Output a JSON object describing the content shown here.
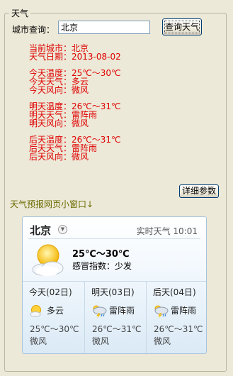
{
  "group_title": "天气",
  "query": {
    "label": "城市查询：",
    "city_value": "北京",
    "button_label": "查询天气"
  },
  "result": {
    "lines": [
      [
        "当前城市：北京",
        "天气日期：2013-08-02"
      ],
      [
        "今天温度：25℃～30℃",
        "今天天气：多云",
        "今天风向：微风"
      ],
      [
        "明天温度：26℃～31℃",
        "明天天气：雷阵雨",
        "明天风向：微风"
      ],
      [
        "后天温度：26℃～31℃",
        "后天天气：雷阵雨",
        "后天风向：微风"
      ]
    ]
  },
  "detail_button_label": "详细参数",
  "widget_label": "天气预报网页小窗口↓",
  "widget": {
    "city": "北京",
    "realtime": "实时天气 10:01",
    "temp": "25℃～30℃",
    "cold_index": "感冒指数：少发",
    "days": [
      {
        "label": "今天(02日)",
        "icon": "partly-cloudy-icon",
        "cond": "多云",
        "temp": "25℃～30℃",
        "wind": "微风"
      },
      {
        "label": "明天(03日)",
        "icon": "thunderstorm-icon",
        "cond": "雷阵雨",
        "temp": "26℃～31℃",
        "wind": "微风"
      },
      {
        "label": "后天(04日)",
        "icon": "thunderstorm-icon",
        "cond": "雷阵雨",
        "temp": "26℃～31℃",
        "wind": "微风"
      }
    ]
  },
  "colors": {
    "result_text": "#e00000",
    "widget_label": "#6b6b00"
  }
}
